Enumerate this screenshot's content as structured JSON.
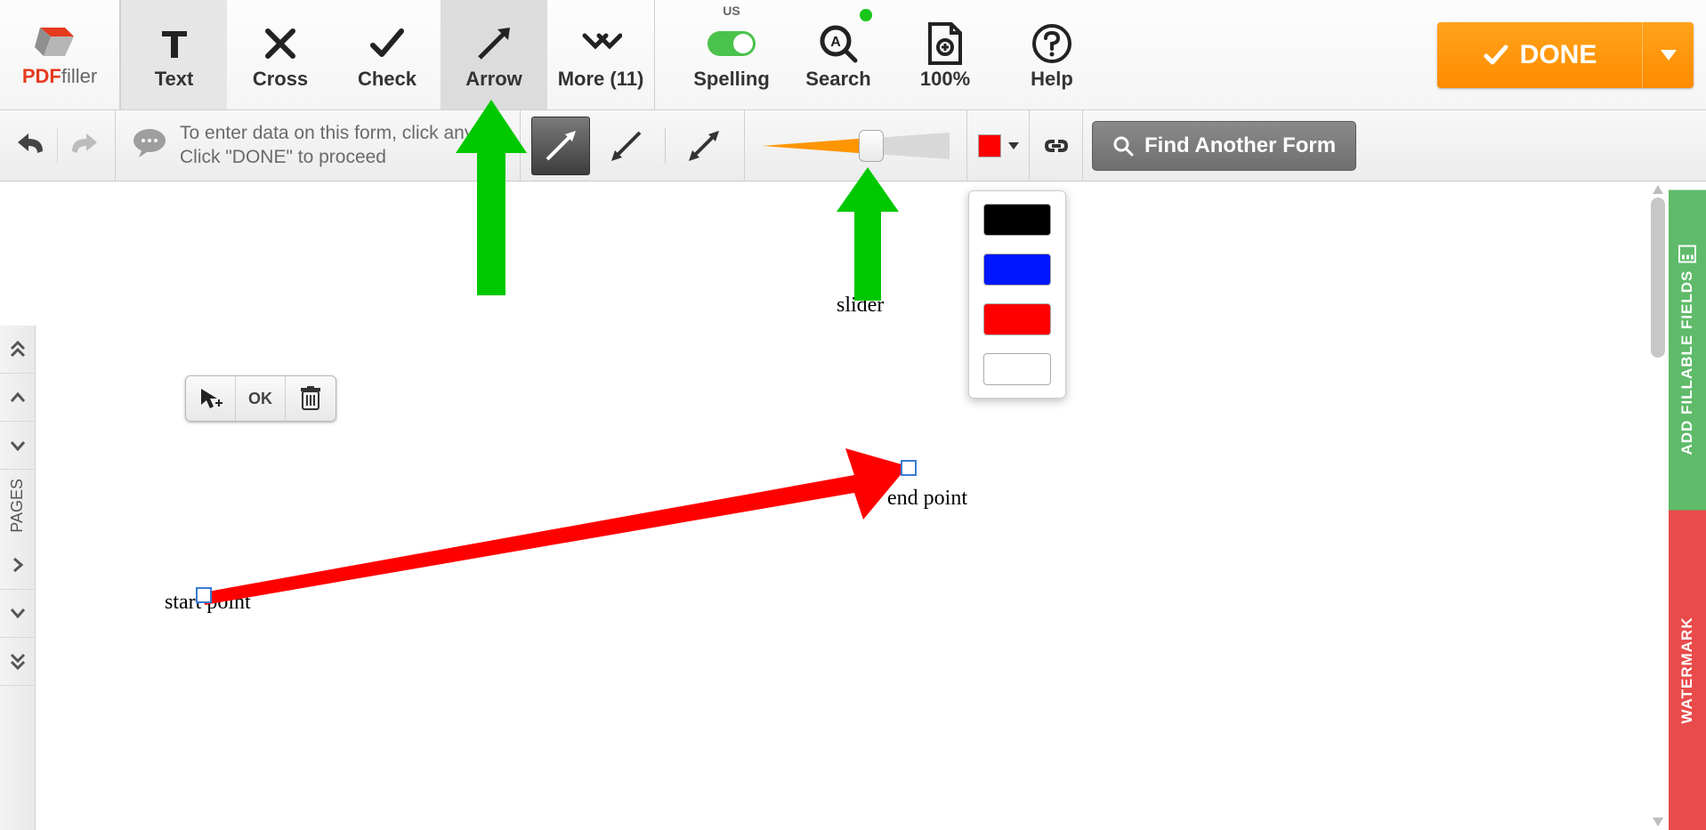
{
  "logo": {
    "pdf": "PDF",
    "filler": "filler"
  },
  "toolbar": {
    "text": "Text",
    "cross": "Cross",
    "check": "Check",
    "arrow": "Arrow",
    "more": "More (11)",
    "spelling_badge": "US",
    "spelling": "Spelling",
    "search": "Search",
    "zoom": "100%",
    "help": "Help",
    "done": "DONE"
  },
  "hint": {
    "line1": "To enter data on this form, click anyw",
    "line2": "Click \"DONE\" to proceed"
  },
  "second_bar": {
    "find_form": "Find Another Form",
    "selected_color": "#ff0000"
  },
  "color_options": [
    {
      "hex": "#000000",
      "selected": false
    },
    {
      "hex": "#0000ff",
      "selected": false
    },
    {
      "hex": "#ff0000",
      "selected": true
    },
    {
      "hex": "#ffffff",
      "selected": false
    }
  ],
  "left_rail": {
    "pages_label": "PAGES"
  },
  "right_rails": {
    "fillable": "ADD FILLABLE FIELDS",
    "watermark": "WATERMARK"
  },
  "float_tools": {
    "ok": "OK"
  },
  "annotations": {
    "slider": "slider",
    "start": "start point",
    "end": "end point"
  }
}
